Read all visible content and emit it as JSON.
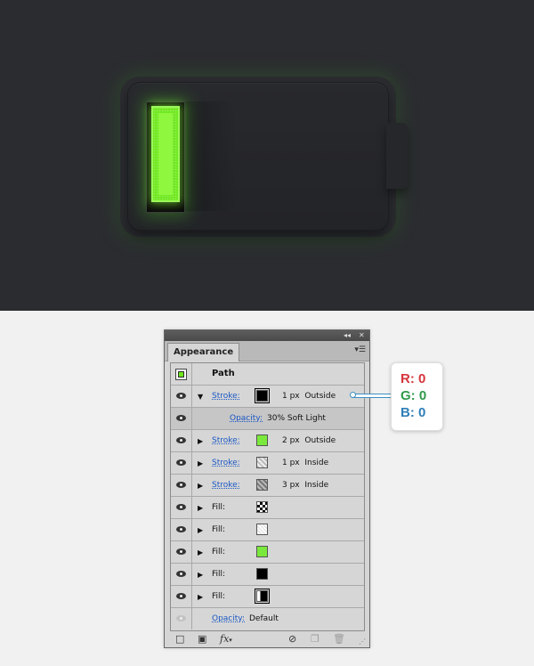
{
  "canvas": {
    "colors": {
      "background": "#2b2c30",
      "battery": "#26272b",
      "charge": "#6ee81c"
    }
  },
  "panel": {
    "tab_label": "Appearance",
    "title_icons": [
      "collapse-icon",
      "close-icon"
    ],
    "object": {
      "label": "Path"
    },
    "rows": [
      {
        "type": "stroke",
        "label": "Stroke:",
        "swatch": "#000000",
        "weight": "1 px",
        "align": "Outside",
        "expanded": true,
        "eye": true
      },
      {
        "type": "opacity",
        "label": "Opacity:",
        "value": "30% Soft Light",
        "eye": true
      },
      {
        "type": "stroke",
        "label": "Stroke:",
        "swatch": "#7be83c",
        "weight": "2 px",
        "align": "Outside",
        "expanded": false,
        "eye": true
      },
      {
        "type": "stroke",
        "label": "Stroke:",
        "swatch": "pattern-light",
        "weight": "1 px",
        "align": "Inside",
        "expanded": false,
        "eye": true
      },
      {
        "type": "stroke",
        "label": "Stroke:",
        "swatch": "pattern-dark",
        "weight": "3 px",
        "align": "Inside",
        "expanded": false,
        "eye": true
      },
      {
        "type": "fill",
        "label": "Fill:",
        "swatch": "pattern-check",
        "eye": true
      },
      {
        "type": "fill",
        "label": "Fill:",
        "swatch": "pattern-dots",
        "eye": true
      },
      {
        "type": "fill",
        "label": "Fill:",
        "swatch": "#7be83c",
        "eye": true
      },
      {
        "type": "fill",
        "label": "Fill:",
        "swatch": "#000000",
        "eye": true
      },
      {
        "type": "fill",
        "label": "Fill:",
        "swatch": "black-gradient",
        "eye": true
      }
    ],
    "footer": {
      "label": "Opacity:",
      "value": "Default"
    },
    "bottom_icons": [
      "new-stroke-icon",
      "new-fill-icon",
      "fx-icon",
      "clear-icon",
      "duplicate-icon",
      "delete-icon"
    ],
    "fx_label": "fx"
  },
  "callout": {
    "r": "R: 0",
    "g": "G: 0",
    "b": "B: 0",
    "colors": {
      "r": "#d6343c",
      "g": "#2e9a4a",
      "b": "#2f7fb8",
      "connector": "#3a8fc2"
    }
  }
}
